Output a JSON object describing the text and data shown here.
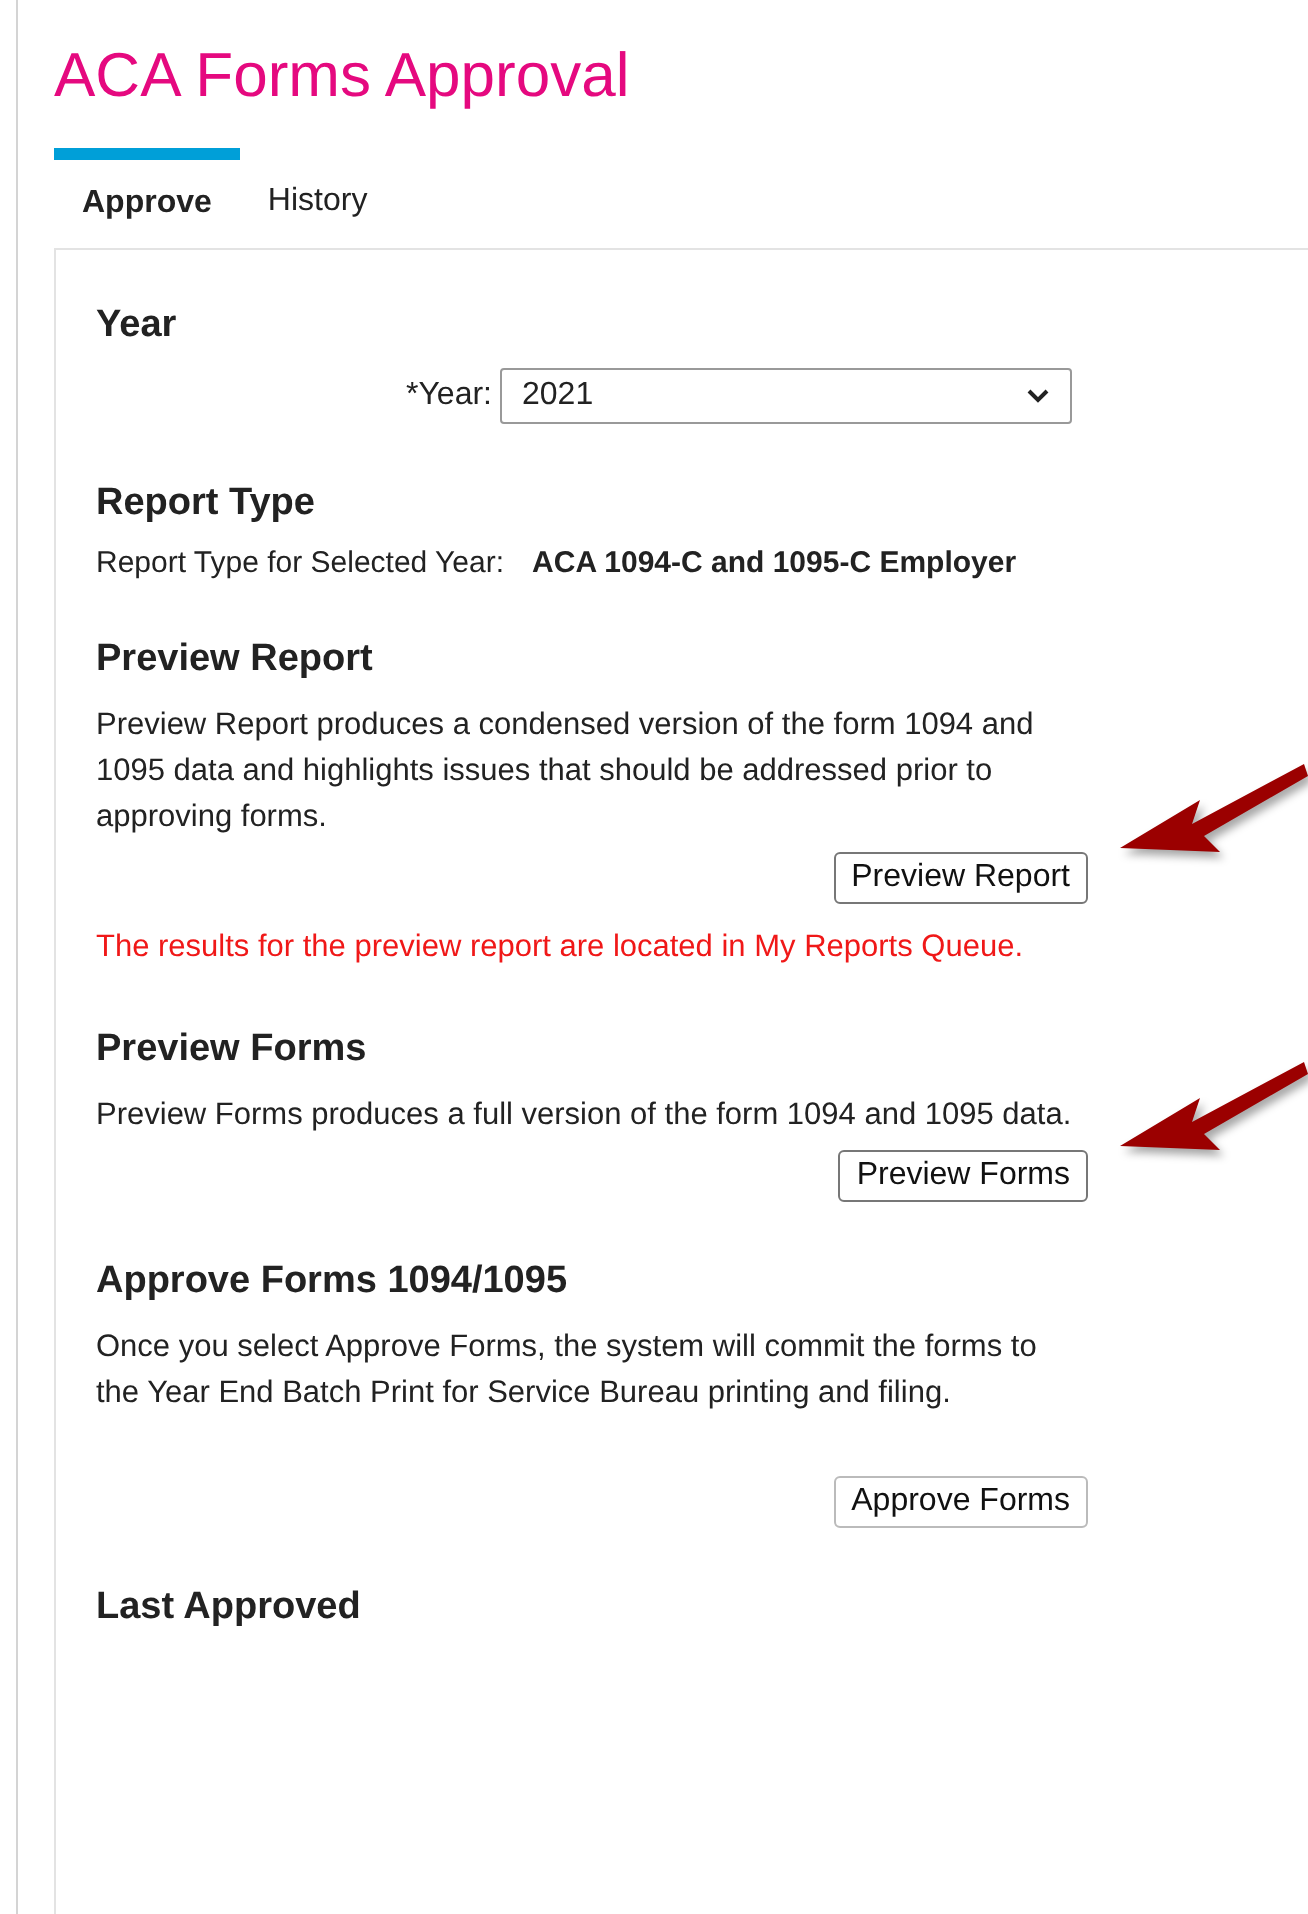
{
  "title": "ACA Forms Approval",
  "tabs": [
    {
      "label": "Approve",
      "selected": true
    },
    {
      "label": "History",
      "selected": false
    }
  ],
  "sections": [
    {
      "kind": "select",
      "heading": "Year",
      "label": "*Year:",
      "value": "2021"
    },
    {
      "kind": "info",
      "heading": "Report Type",
      "label": "Report Type for Selected Year:",
      "value": "ACA 1094-C and 1095-C Employer"
    },
    {
      "kind": "action",
      "heading": "Preview Report",
      "text": "Preview Report produces a condensed version of the form 1094 and 1095 data and highlights issues that should be addressed prior to approving forms.",
      "button": "Preview Report",
      "arrow": true,
      "note": "The results for the preview report are located in My Reports Queue."
    },
    {
      "kind": "action",
      "heading": "Preview Forms",
      "text": "Preview Forms produces a full version of the form 1094 and 1095 data.",
      "button": "Preview Forms",
      "arrow": true
    },
    {
      "kind": "action",
      "heading": "Approve Forms 1094/1095",
      "text": "Once you select Approve Forms, the system will commit the forms to the Year End Batch Print for Service Bureau printing and filing.",
      "button": "Approve Forms",
      "arrow": false
    },
    {
      "kind": "heading",
      "heading": "Last Approved"
    }
  ]
}
